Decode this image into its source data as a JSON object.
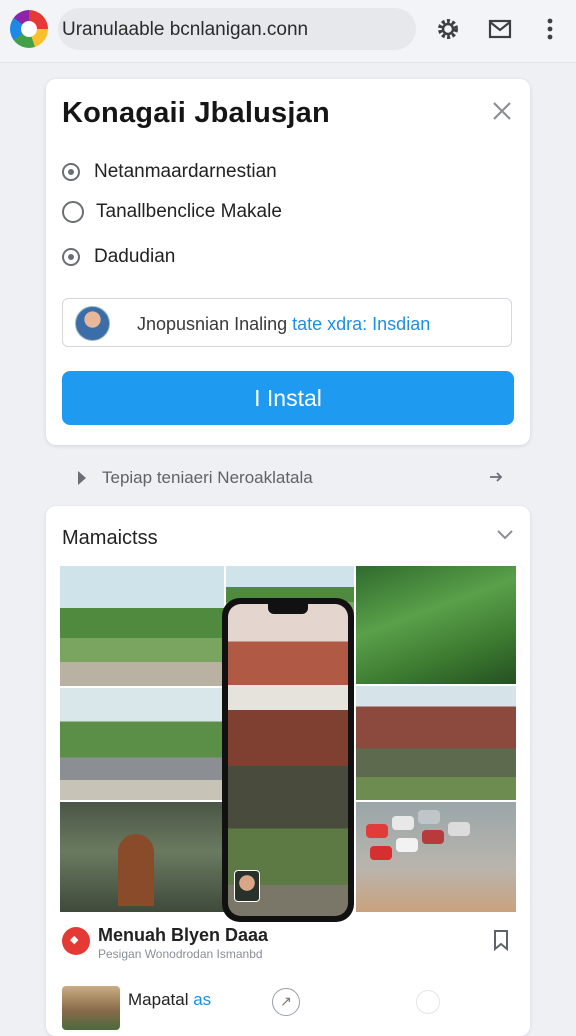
{
  "header": {
    "url_text": "Uranulaable bcnlanigan.conn",
    "icons": [
      "app-logo",
      "settings-icon",
      "mail-icon",
      "more-vert-icon"
    ]
  },
  "install_dialog": {
    "title": "Konagaii Jbalusjan",
    "options": [
      {
        "label": "Netanmaardarnestian",
        "selected": true
      },
      {
        "label": "Tanallbenclice Makale",
        "selected": false
      },
      {
        "label": "Dadudian",
        "selected": true
      }
    ],
    "field_text_plain": "Jnopusnian Inaling ",
    "field_text_highlight": "tate xdra: Insdian",
    "install_label": "I Instal"
  },
  "hint": {
    "text": "Tepiap teniaeri Neroaklatala"
  },
  "media_card": {
    "title": "Mamaictss",
    "listing_title": "Menuah Blyen Daaa",
    "listing_subtitle": "Pesigan Wonodrodan Ismanbd",
    "row2_title_plain": "Mapatal ",
    "row2_title_highlight": "as"
  },
  "colors": {
    "accent": "#1e9bf0",
    "badge": "#e53935",
    "background": "#eef0f4"
  }
}
